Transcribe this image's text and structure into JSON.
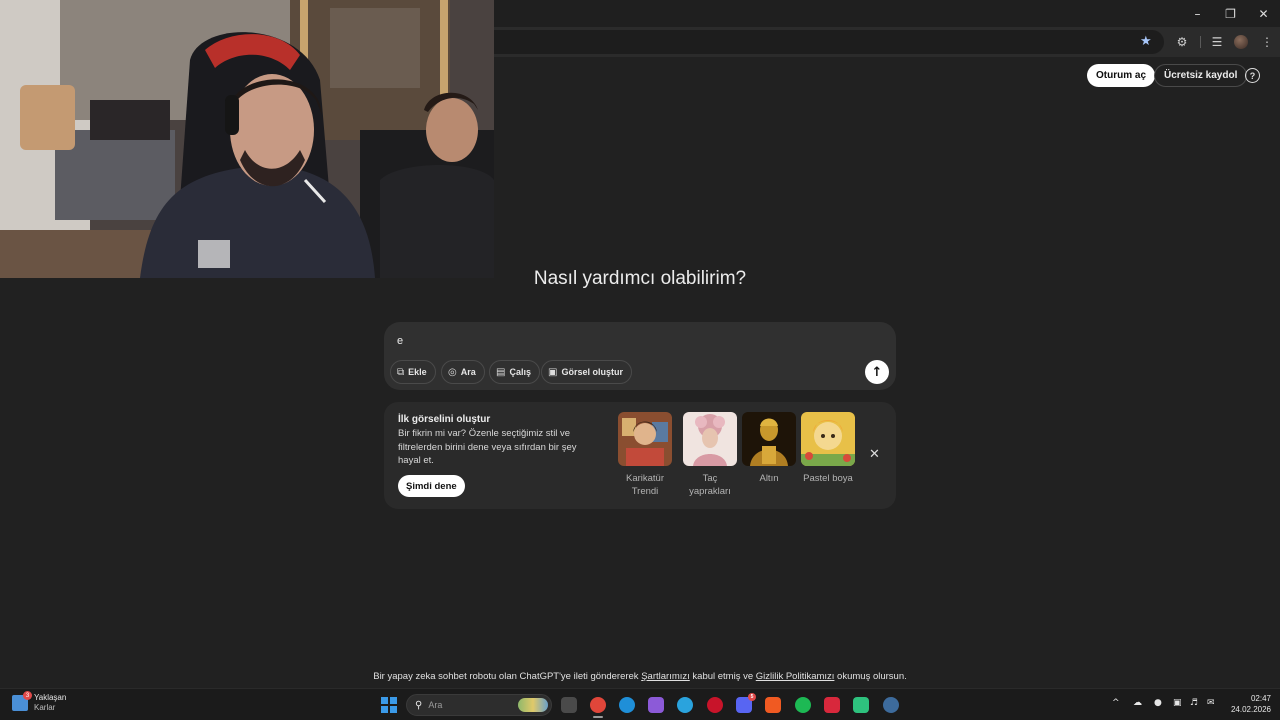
{
  "window": {
    "minimize_icon": "minimize-icon",
    "restore_icon": "restore-icon",
    "close_icon": "close-icon"
  },
  "header": {
    "login_label": "Oturum aç",
    "signup_label": "Ücretsiz kaydol",
    "help_icon": "?"
  },
  "main": {
    "headline": "Nasıl yardımcı olabilirim?",
    "composer": {
      "text": "e",
      "chips": [
        {
          "icon": "paperclip-icon",
          "label": "Ekle"
        },
        {
          "icon": "globe-icon",
          "label": "Ara"
        },
        {
          "icon": "book-icon",
          "label": "Çalış"
        },
        {
          "icon": "image-icon",
          "label": "Görsel oluştur"
        }
      ],
      "send_icon": "arrow-up-icon"
    },
    "promo": {
      "title": "İlk görselini oluştur",
      "description": "Bir fikrin mi var? Özenle seçtiğimiz stil ve filtrelerden birini dene veya sıfırdan bir şey hayal et.",
      "button": "Şimdi dene",
      "styles": [
        {
          "label": "Karikatür Trendi",
          "color": "#a5613a"
        },
        {
          "label": "Taç yaprakları",
          "color": "#e2b6b2"
        },
        {
          "label": "Altın",
          "color": "#b8862a"
        },
        {
          "label": "Pastel boya",
          "color": "#e8b83a"
        }
      ]
    },
    "disclaimer": {
      "pre": "Bir yapay zeka sohbet robotu olan ChatGPT'ye ileti göndererek ",
      "terms": "Şartlarımızı",
      "mid": " kabul etmiş ve ",
      "privacy": "Gizlilik Politikamızı",
      "post": " okumuş olursun."
    }
  },
  "taskbar": {
    "weather_title": "Yaklaşan",
    "weather_sub": "Karlar",
    "weather_badge": "3",
    "search_placeholder": "Ara",
    "discord_badge": "5",
    "time": "02:47",
    "date": "24.02.2026",
    "apps": [
      {
        "name": "task-view-icon",
        "color": "#3a3a3a"
      },
      {
        "name": "chrome-icon",
        "color": "#e0463a"
      },
      {
        "name": "edge-icon",
        "color": "#1f8fd8"
      },
      {
        "name": "copilot-icon",
        "color": "#8c5ad8"
      },
      {
        "name": "telegram-icon",
        "color": "#2aa3dd"
      },
      {
        "name": "opera-icon",
        "color": "#c8142a"
      },
      {
        "name": "discord-icon",
        "color": "#5865f2"
      },
      {
        "name": "brave-icon",
        "color": "#f05a22"
      },
      {
        "name": "spotify-icon",
        "color": "#1db954"
      },
      {
        "name": "red-app-icon",
        "color": "#d8283c"
      },
      {
        "name": "green-app-icon",
        "color": "#2ec27e"
      },
      {
        "name": "settings-icon",
        "color": "#3d6b9c"
      }
    ]
  }
}
